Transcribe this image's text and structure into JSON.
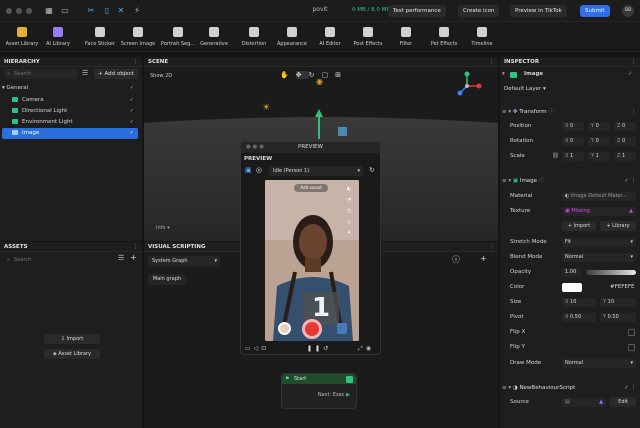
{
  "titlebar": {
    "project_name": "povit",
    "memory": "0 MB / 8.0 MB",
    "test_performance": "Test performance",
    "create_icon": "Create icon",
    "preview_tiktok": "Preview in TikTok",
    "submit": "Submit",
    "avatar_initials": "DB"
  },
  "toolbar": {
    "items": [
      {
        "label": "Asset Library"
      },
      {
        "label": "AI Library"
      },
      {
        "label": "Face Sticker"
      },
      {
        "label": "Screen Image"
      },
      {
        "label": "Portrait Seg..."
      },
      {
        "label": "Generative"
      },
      {
        "label": "Distortion"
      },
      {
        "label": "Appearance"
      },
      {
        "label": "AI Editor"
      },
      {
        "label": "Post Effects"
      },
      {
        "label": "Filter"
      },
      {
        "label": "Pet Effects"
      },
      {
        "label": "Timeline"
      }
    ]
  },
  "hierarchy": {
    "title": "HIERARCHY",
    "search_placeholder": "Search",
    "add_object": "+ Add object",
    "group": "General",
    "items": [
      {
        "label": "Camera"
      },
      {
        "label": "Directional Light"
      },
      {
        "label": "Environment Light"
      },
      {
        "label": "Image"
      }
    ]
  },
  "assets": {
    "title": "ASSETS",
    "search_placeholder": "Search",
    "import": "Import",
    "asset_library": "Asset Library"
  },
  "scene": {
    "title": "SCENE",
    "show2d": "Show 2D",
    "info": "Info"
  },
  "visual_scripting": {
    "title": "VISUAL SCRIPTING",
    "graph_select": "System Graph",
    "main_graph": "Main graph",
    "start_node": "Start",
    "next_exec": "Next: Exec"
  },
  "preview": {
    "window_title": "PREVIEW",
    "label": "PREVIEW",
    "select": "Idle (Person 1)",
    "add_sound": "Add sound",
    "countdown": "1"
  },
  "inspector": {
    "title": "INSPECTOR",
    "object_name": "Image",
    "layer": "Default Layer",
    "transform": {
      "title": "Transform",
      "position": {
        "label": "Position",
        "x": "0",
        "y": "0",
        "z": "0"
      },
      "rotation": {
        "label": "Rotation",
        "x": "0",
        "y": "0",
        "z": "0"
      },
      "scale": {
        "label": "Scale",
        "x": "1",
        "y": "1",
        "z": "1"
      }
    },
    "image": {
      "title": "Image",
      "material_label": "Material",
      "material_value": "Image Default Mater...",
      "texture_label": "Texture",
      "texture_value": "Missing",
      "import": "+ Import",
      "library": "+ Library",
      "stretch_label": "Stretch Mode",
      "stretch_value": "Fit",
      "blend_label": "Blend Mode",
      "blend_value": "Normal",
      "opacity_label": "Opacity",
      "opacity_value": "1.00",
      "color_label": "Color",
      "color_value": "#FEFEFE",
      "size_label": "Size",
      "size_x": "10",
      "size_y": "10",
      "pivot_label": "Pivot",
      "pivot_x": "0.50",
      "pivot_y": "0.50",
      "flipx_label": "Flip X",
      "flipy_label": "Flip Y",
      "draw_label": "Draw Mode",
      "draw_value": "Normal"
    },
    "script": {
      "title": "NewBehaviourScript",
      "source_label": "Source",
      "edit": "Edit"
    }
  },
  "colors": {
    "accent": "#2f6fe8",
    "selection": "#2a6fdb",
    "missing": "#e040fb",
    "start_node": "#1f4d2c",
    "record": "#e53935"
  }
}
